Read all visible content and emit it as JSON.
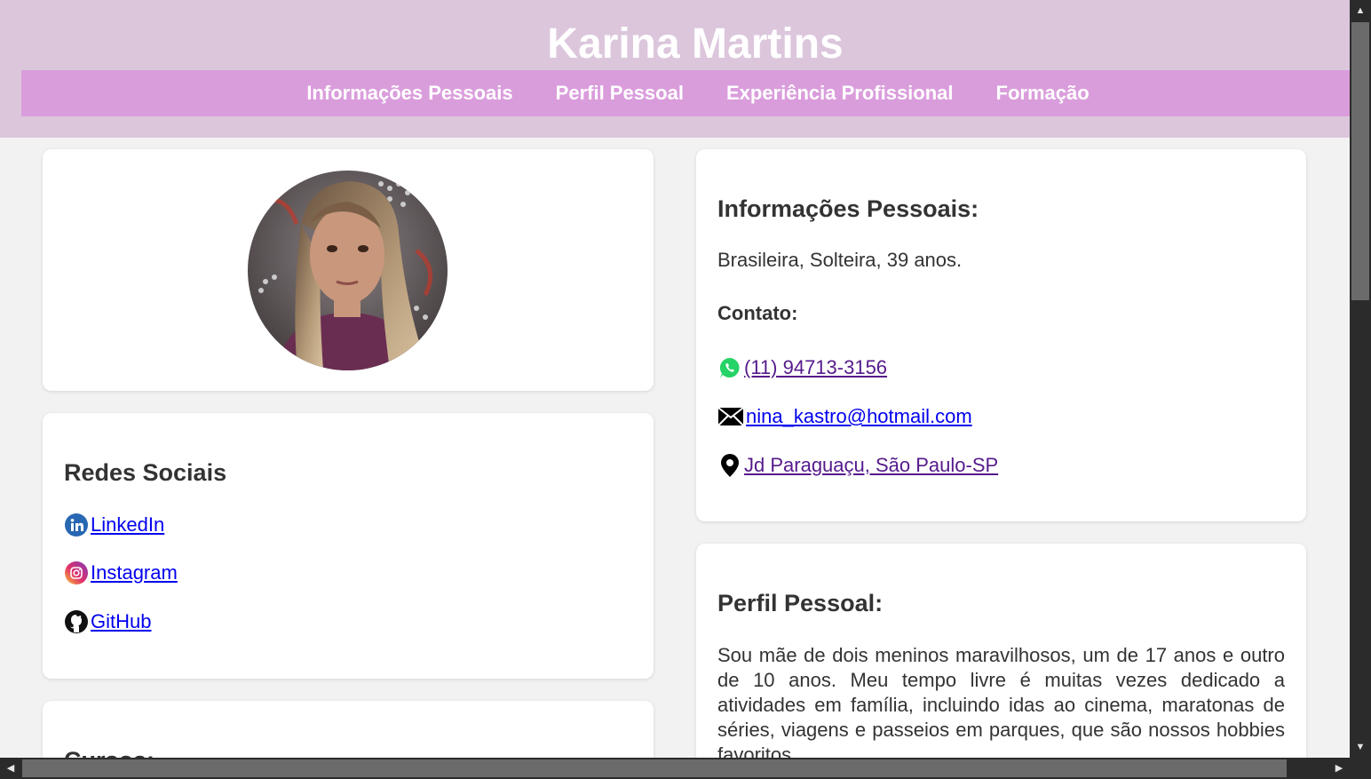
{
  "header": {
    "title": "Karina Martins",
    "nav": [
      "Informações Pessoais",
      "Perfil Pessoal",
      "Experiência Profissional",
      "Formação"
    ]
  },
  "photo": {
    "icon": "profile-photo"
  },
  "social": {
    "title": "Redes Sociais",
    "links": [
      {
        "label": " LinkedIn",
        "icon": "linkedin-icon"
      },
      {
        "label": " Instagram",
        "icon": "instagram-icon"
      },
      {
        "label": " GitHub",
        "icon": "github-icon"
      }
    ]
  },
  "courses": {
    "title": "Cursos:"
  },
  "info": {
    "title": "Informações Pessoais:",
    "summary": "Brasileira, Solteira, 39 anos.",
    "contact_title": "Contato:",
    "contacts": [
      {
        "label": " (11) 94713-3156",
        "icon": "whatsapp-icon"
      },
      {
        "label": " nina_kastro@hotmail.com",
        "icon": "email-icon"
      },
      {
        "label": " Jd Paraguaçu, São Paulo-SP",
        "icon": "location-pin-icon"
      }
    ]
  },
  "profile": {
    "title": "Perfil Pessoal:",
    "text": "Sou mãe de dois meninos maravilhosos, um de 17 anos e outro de 10 anos. Meu tempo livre é muitas vezes dedicado a atividades em família, incluindo idas ao cinema, maratonas de séries, viagens e passeios em parques, que são nossos hobbies favoritos."
  },
  "colors": {
    "header_bg": "#dcc6dc",
    "nav_bg": "#da9ddc",
    "page_bg": "#f3f2f3",
    "link": "#0000ee",
    "link_visited": "#551a8b"
  }
}
